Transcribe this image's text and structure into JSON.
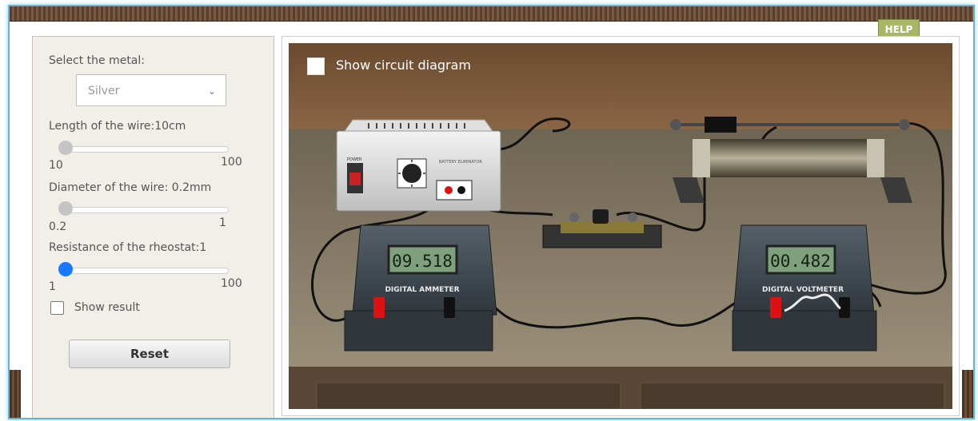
{
  "help": "HELP",
  "controls": {
    "metal_label": "Select the metal:",
    "metal_value": "Silver",
    "length_label": "Length of the wire:10cm",
    "length_min": "10",
    "length_max": "100",
    "length_value_fraction": 0,
    "diameter_label": "Diameter of the wire:  0.2mm",
    "diameter_min": "0.2",
    "diameter_max": "1",
    "diameter_value_fraction": 0,
    "resistance_label": "Resistance of the rheostat:1",
    "resistance_min": "1",
    "resistance_max": "100",
    "resistance_value_fraction": 0,
    "show_result_label": "Show result",
    "show_result_checked": false,
    "reset_label": "Reset"
  },
  "stage": {
    "circuit_label": "Show circuit diagram",
    "circuit_checked": false,
    "ammeter_reading": "09.518",
    "ammeter_label": "DIGITAL AMMETER",
    "voltmeter_reading": "00.482",
    "voltmeter_label": "DIGITAL VOLTMETER",
    "battery_label": "BATTERY ELIMINATOR",
    "power_label": "POWER"
  },
  "colors": {
    "accent": "#1878ff",
    "help_bg": "#a7b766",
    "lcd": "#7fa07c",
    "wall": "#6b4a2f",
    "table": "#857a67"
  }
}
